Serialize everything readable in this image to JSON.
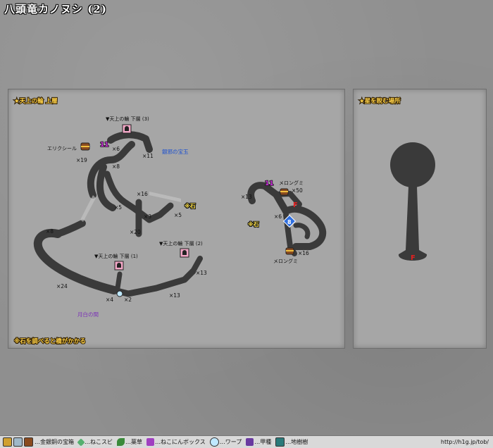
{
  "title": "八頭竜カノヌシ (2)",
  "panels": {
    "upper": {
      "heading": "★天上の輪 上層",
      "note": "※石を調べると橋がかかる"
    },
    "star": {
      "heading": "★星を睨む場所"
    }
  },
  "labels": {
    "lower_3": "▼天上の輪 下層 (3)",
    "lower_1": "▼天上の輪 下層 (1)",
    "lower_2": "▼天上の輪 下層 (2)",
    "elixir": "エリクシール",
    "silver_orb": "銀邪の宝玉",
    "moon_door": "月白の間",
    "melon_top": "メロングミ",
    "melon_bottom": "メロングミ",
    "stone": "※石",
    "num11": "11",
    "f": "F",
    "e8": "8"
  },
  "counts": {
    "c6": "×6",
    "c11": "×11",
    "c19": "×19",
    "c8": "×8",
    "c16": "×16",
    "c5a": "×5",
    "c3": "×3",
    "c5b": "×5",
    "c20": "×20",
    "c8b": "×8",
    "c24": "×24",
    "c4": "×4",
    "c2": "×2",
    "c13a": "×13",
    "c13b": "×13",
    "r13": "×13",
    "r50": "×50",
    "r6": "×6",
    "r16": "×16"
  },
  "legend": {
    "chest": "…金銀銅の宝箱",
    "nekosubi": "…ねこスビ",
    "herb": "…薬草",
    "nekobox": "…ねこにんボックス",
    "warp": "…ワープ",
    "beetle": "…甲種",
    "tree": "…地樹樹",
    "credit": "http://h1g.jp/tob/"
  }
}
